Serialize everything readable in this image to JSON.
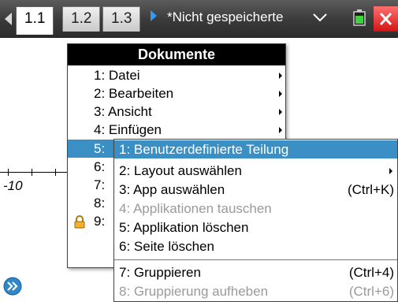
{
  "tabs": [
    {
      "label": "1.1",
      "active": true
    },
    {
      "label": "1.2",
      "active": false
    },
    {
      "label": "1.3",
      "active": false
    }
  ],
  "document_title": "*Nicht gespeicherte",
  "graph": {
    "x_tick_label": "-10"
  },
  "menu": {
    "title": "Dokumente",
    "items": [
      {
        "label": "1: Datei",
        "submenu": true
      },
      {
        "label": "2: Bearbeiten",
        "submenu": true
      },
      {
        "label": "3: Ansicht",
        "submenu": true
      },
      {
        "label": "4: Einfügen",
        "submenu": true
      },
      {
        "label": "5:",
        "submenu": true,
        "highlighted": true
      },
      {
        "label": "6:"
      },
      {
        "label": "7:"
      },
      {
        "label": "8:"
      },
      {
        "label": "9:"
      }
    ]
  },
  "submenu": {
    "items": [
      {
        "label": "1: Benutzerdefinierte Teilung",
        "shortcut": "",
        "highlighted": true
      },
      {
        "label": "2: Layout auswählen",
        "shortcut": "",
        "submenu": true
      },
      {
        "label": "3: App auswählen",
        "shortcut": "(Ctrl+K)"
      },
      {
        "label": "4: Applikationen tauschen",
        "shortcut": "",
        "disabled": true
      },
      {
        "label": "5: Applikation löschen",
        "shortcut": ""
      },
      {
        "label": "6: Seite löschen",
        "shortcut": ""
      },
      {
        "label": "7: Gruppieren",
        "shortcut": "(Ctrl+4)"
      },
      {
        "label": "8: Gruppierung aufheben",
        "shortcut": "(Ctrl+6)",
        "disabled": true
      }
    ]
  },
  "colors": {
    "highlight": "#3a8fc5",
    "tabbar": "#3a3a3a",
    "close": "#d21515",
    "disabled_text": "#9a9a9a"
  },
  "icons": [
    "left-arrow-icon",
    "right-arrow-icon",
    "chevron-down-icon",
    "battery-icon",
    "close-icon",
    "lock-icon",
    "expand-icon"
  ]
}
